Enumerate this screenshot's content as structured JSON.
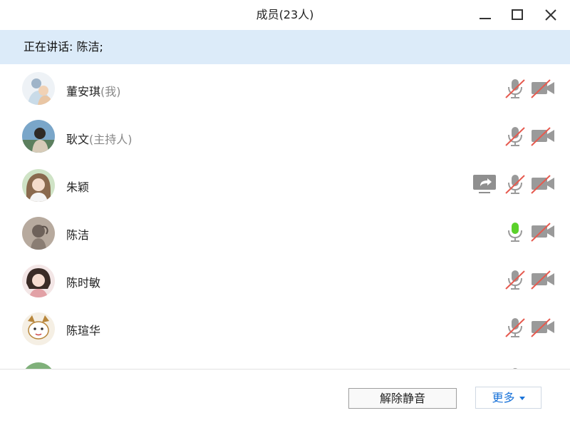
{
  "window": {
    "title": "成员(23人)",
    "controls": [
      "minimize-icon",
      "maximize-icon",
      "close-icon"
    ]
  },
  "speaking": {
    "label": "正在讲话: 陈洁;"
  },
  "members": [
    {
      "name": "董安琪",
      "role": "(我)",
      "mic": "muted",
      "camera": "off",
      "sharing": false
    },
    {
      "name": "耿文",
      "role": "(主持人)",
      "mic": "muted",
      "camera": "off",
      "sharing": false
    },
    {
      "name": "朱颖",
      "role": "",
      "mic": "muted",
      "camera": "off",
      "sharing": true
    },
    {
      "name": "陈洁",
      "role": "",
      "mic": "speaking",
      "camera": "off",
      "sharing": false
    },
    {
      "name": "陈时敏",
      "role": "",
      "mic": "muted",
      "camera": "off",
      "sharing": false
    },
    {
      "name": "陈瑄华",
      "role": "",
      "mic": "muted",
      "camera": "off",
      "sharing": false
    }
  ],
  "footer": {
    "unmute_label": "解除静音",
    "more_label": "更多"
  },
  "colors": {
    "speaking_bar": "#dcebf9",
    "icon_gray": "#9a9a9a",
    "muted_slash": "#e65a4f",
    "mic_active": "#5ad12a",
    "link_blue": "#1a73d9"
  }
}
